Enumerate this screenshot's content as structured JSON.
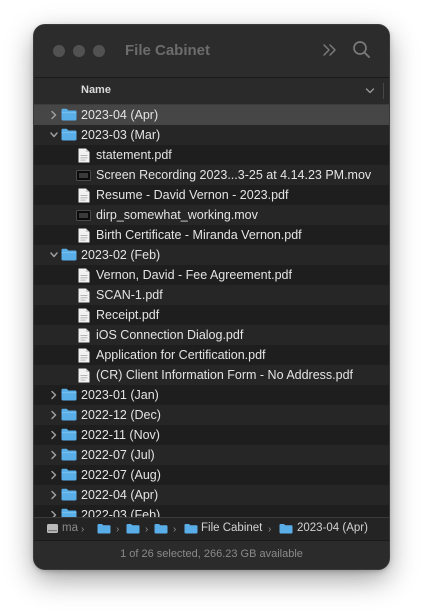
{
  "window": {
    "title": "File Cabinet"
  },
  "toolbar": {
    "more_icon": "chevron-double-right-icon",
    "search_icon": "search-icon"
  },
  "columns": {
    "name": "Name"
  },
  "rows": [
    {
      "label": "2023-04 (Apr)",
      "kind": "folder",
      "level": 0,
      "expanded": false,
      "selected": true
    },
    {
      "label": "2023-03 (Mar)",
      "kind": "folder",
      "level": 0,
      "expanded": true
    },
    {
      "label": "statement.pdf",
      "kind": "pdf",
      "level": 1
    },
    {
      "label": "Screen Recording 2023...3-25 at 4.14.23 PM.mov",
      "kind": "movie",
      "level": 1
    },
    {
      "label": "Resume - David Vernon - 2023.pdf",
      "kind": "pdf",
      "level": 1
    },
    {
      "label": "dirp_somewhat_working.mov",
      "kind": "movie",
      "level": 1
    },
    {
      "label": "Birth Certificate - Miranda Vernon.pdf",
      "kind": "pdf",
      "level": 1
    },
    {
      "label": "2023-02 (Feb)",
      "kind": "folder",
      "level": 0,
      "expanded": true
    },
    {
      "label": "Vernon, David - Fee Agreement.pdf",
      "kind": "pdf",
      "level": 1
    },
    {
      "label": "SCAN-1.pdf",
      "kind": "pdf",
      "level": 1
    },
    {
      "label": "Receipt.pdf",
      "kind": "pdf",
      "level": 1
    },
    {
      "label": "iOS Connection Dialog.pdf",
      "kind": "pdf",
      "level": 1
    },
    {
      "label": "Application for Certification.pdf",
      "kind": "pdf",
      "level": 1
    },
    {
      "label": "(CR) Client Information Form - No Address.pdf",
      "kind": "pdf",
      "level": 1
    },
    {
      "label": "2023-01 (Jan)",
      "kind": "folder",
      "level": 0,
      "expanded": false
    },
    {
      "label": "2022-12 (Dec)",
      "kind": "folder",
      "level": 0,
      "expanded": false
    },
    {
      "label": "2022-11 (Nov)",
      "kind": "folder",
      "level": 0,
      "expanded": false
    },
    {
      "label": "2022-07 (Jul)",
      "kind": "folder",
      "level": 0,
      "expanded": false
    },
    {
      "label": "2022-07 (Aug)",
      "kind": "folder",
      "level": 0,
      "expanded": false
    },
    {
      "label": "2022-04 (Apr)",
      "kind": "folder",
      "level": 0,
      "expanded": false
    },
    {
      "label": "2022-03 (Feb)",
      "kind": "folder",
      "level": 0,
      "expanded": false
    }
  ],
  "pathbar": {
    "disk": "ma",
    "folder_parent": "File Cabinet",
    "folder_current": "2023-04 (Apr)"
  },
  "status": {
    "text": "1 of 26 selected, 266.23 GB available"
  },
  "colors": {
    "folder": "#5aaee8",
    "window_bg": "#1e1e1e",
    "selection": "#464646"
  }
}
